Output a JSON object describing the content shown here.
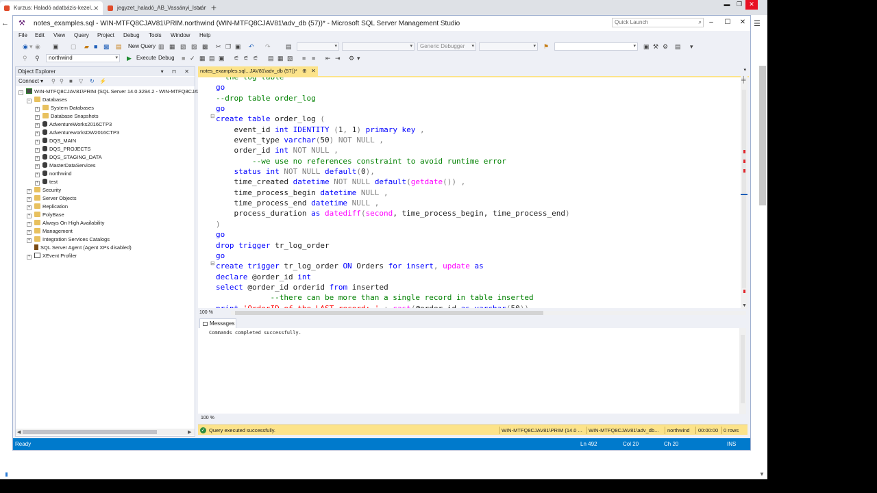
{
  "browser": {
    "tabs": [
      {
        "label": "Kurzus: Haladó adatbázis-kezel...",
        "active": true
      },
      {
        "label": "jegyzet_haladó_AB_Vassányi_István...",
        "active": false
      }
    ],
    "new_tab": "+",
    "window_controls": {
      "minimize": "▬",
      "maximize": "❐",
      "close": "✕"
    },
    "menu_icon": "☰",
    "back_icon": "←"
  },
  "ssms": {
    "title": "notes_examples.sql - WIN-MTFQ8CJAV81\\PRIM.northwind (WIN-MTFQ8CJAV81\\adv_db (57))* - Microsoft SQL Server Management Studio",
    "quick_launch": {
      "placeholder": "Quick Launch",
      "icon": "search-icon"
    },
    "window_controls": {
      "minimize": "‒",
      "maximize": "☐",
      "close": "✕"
    },
    "menu": [
      "File",
      "Edit",
      "View",
      "Query",
      "Project",
      "Debug",
      "Tools",
      "Window",
      "Help"
    ],
    "toolbar1": {
      "new_query": "New Query",
      "generic_debugger": "Generic Debugger"
    },
    "toolbar2": {
      "database": "northwind",
      "execute": "Execute",
      "debug": "Debug"
    },
    "object_explorer": {
      "title": "Object Explorer",
      "header_buttons": "▾ ⊓ ✕",
      "connect": "Connect ▾",
      "tree": [
        {
          "label": "WIN-MTFQ8CJAV81\\PRIM (SQL Server 14.0.3294.2 - WIN-MTFQ8CJAV81\\adv_db)",
          "level": 0,
          "icon": "server",
          "expander": "−"
        },
        {
          "label": "Databases",
          "level": 1,
          "icon": "folder",
          "expander": "−"
        },
        {
          "label": "System Databases",
          "level": 2,
          "icon": "folder",
          "expander": "+"
        },
        {
          "label": "Database Snapshots",
          "level": 2,
          "icon": "folder",
          "expander": "+"
        },
        {
          "label": "AdventureWorks2016CTP3",
          "level": 2,
          "icon": "db",
          "expander": "+"
        },
        {
          "label": "AdventureworksDW2016CTP3",
          "level": 2,
          "icon": "db",
          "expander": "+"
        },
        {
          "label": "DQS_MAIN",
          "level": 2,
          "icon": "db",
          "expander": "+"
        },
        {
          "label": "DQS_PROJECTS",
          "level": 2,
          "icon": "db",
          "expander": "+"
        },
        {
          "label": "DQS_STAGING_DATA",
          "level": 2,
          "icon": "db",
          "expander": "+"
        },
        {
          "label": "MasterDataServices",
          "level": 2,
          "icon": "db",
          "expander": "+"
        },
        {
          "label": "northwind",
          "level": 2,
          "icon": "db",
          "expander": "+"
        },
        {
          "label": "test",
          "level": 2,
          "icon": "db",
          "expander": "+"
        },
        {
          "label": "Security",
          "level": 1,
          "icon": "folder",
          "expander": "+"
        },
        {
          "label": "Server Objects",
          "level": 1,
          "icon": "folder",
          "expander": "+"
        },
        {
          "label": "Replication",
          "level": 1,
          "icon": "folder",
          "expander": "+"
        },
        {
          "label": "PolyBase",
          "level": 1,
          "icon": "folder",
          "expander": "+"
        },
        {
          "label": "Always On High Availability",
          "level": 1,
          "icon": "folder",
          "expander": "+"
        },
        {
          "label": "Management",
          "level": 1,
          "icon": "folder",
          "expander": "+"
        },
        {
          "label": "Integration Services Catalogs",
          "level": 1,
          "icon": "folder",
          "expander": "+"
        },
        {
          "label": "SQL Server Agent (Agent XPs disabled)",
          "level": 1,
          "icon": "agent",
          "expander": ""
        },
        {
          "label": "XEvent Profiler",
          "level": 1,
          "icon": "xevent",
          "expander": "+"
        }
      ]
    },
    "document_tab": {
      "label": "notes_examples.sql...JAV81\\adv_db (57))*",
      "pin": "⊕",
      "close": "✕"
    },
    "editor": {
      "zoom": "100 %",
      "lines": [
        [
          {
            "t": "  ",
            "c": "dk"
          },
          {
            "t": "the log table",
            "c": "cm"
          }
        ],
        [
          {
            "t": "go",
            "c": "kw"
          }
        ],
        [
          {
            "t": "--drop table order_log",
            "c": "cm"
          }
        ],
        [
          {
            "t": "go",
            "c": "kw"
          }
        ],
        [
          {
            "t": "create table",
            "c": "kw"
          },
          {
            "t": " order_log ",
            "c": "dk"
          },
          {
            "t": "(",
            "c": "gr"
          }
        ],
        [
          {
            "t": "    event_id ",
            "c": "dk"
          },
          {
            "t": "int IDENTITY",
            "c": "kw"
          },
          {
            "t": " (",
            "c": "gr"
          },
          {
            "t": "1",
            "c": "dk"
          },
          {
            "t": ", ",
            "c": "gr"
          },
          {
            "t": "1",
            "c": "dk"
          },
          {
            "t": ") ",
            "c": "gr"
          },
          {
            "t": "primary key",
            "c": "kw"
          },
          {
            "t": " ,",
            "c": "gr"
          }
        ],
        [
          {
            "t": "    event_type ",
            "c": "dk"
          },
          {
            "t": "varchar",
            "c": "kw"
          },
          {
            "t": "(",
            "c": "gr"
          },
          {
            "t": "50",
            "c": "dk"
          },
          {
            "t": ") NOT NULL ,",
            "c": "gr"
          }
        ],
        [
          {
            "t": "    order_id ",
            "c": "dk"
          },
          {
            "t": "int",
            "c": "kw"
          },
          {
            "t": " NOT NULL ,",
            "c": "gr"
          }
        ],
        [
          {
            "t": "        --we use no references constraint to avoid runtime error",
            "c": "cm"
          }
        ],
        [
          {
            "t": "    status ",
            "c": "kw"
          },
          {
            "t": "int",
            "c": "kw"
          },
          {
            "t": " NOT NULL ",
            "c": "gr"
          },
          {
            "t": "default",
            "c": "kw"
          },
          {
            "t": "(",
            "c": "gr"
          },
          {
            "t": "0",
            "c": "dk"
          },
          {
            "t": "),",
            "c": "gr"
          }
        ],
        [
          {
            "t": "    time_created ",
            "c": "dk"
          },
          {
            "t": "datetime",
            "c": "kw"
          },
          {
            "t": " NOT NULL ",
            "c": "gr"
          },
          {
            "t": "default",
            "c": "kw"
          },
          {
            "t": "(",
            "c": "gr"
          },
          {
            "t": "getdate",
            "c": "fn"
          },
          {
            "t": "()) ,",
            "c": "gr"
          }
        ],
        [
          {
            "t": "    time_process_begin ",
            "c": "dk"
          },
          {
            "t": "datetime",
            "c": "kw"
          },
          {
            "t": " NULL ,",
            "c": "gr"
          }
        ],
        [
          {
            "t": "    time_process_end ",
            "c": "dk"
          },
          {
            "t": "datetime",
            "c": "kw"
          },
          {
            "t": " NULL ,",
            "c": "gr"
          }
        ],
        [
          {
            "t": "    process_duration ",
            "c": "dk"
          },
          {
            "t": "as",
            "c": "kw"
          },
          {
            "t": " ",
            "c": "dk"
          },
          {
            "t": "datediff",
            "c": "fn"
          },
          {
            "t": "(",
            "c": "gr"
          },
          {
            "t": "second",
            "c": "fn"
          },
          {
            "t": ", time_process_begin, time_process_end",
            "c": "dk"
          },
          {
            "t": ")",
            "c": "gr"
          }
        ],
        [
          {
            "t": ")",
            "c": "gr"
          }
        ],
        [
          {
            "t": "go",
            "c": "kw"
          }
        ],
        [
          {
            "t": "drop trigger",
            "c": "kw"
          },
          {
            "t": " tr_log_order",
            "c": "dk"
          }
        ],
        [
          {
            "t": "go",
            "c": "kw"
          }
        ],
        [
          {
            "t": "create trigger",
            "c": "kw"
          },
          {
            "t": " tr_log_order ",
            "c": "dk"
          },
          {
            "t": "ON",
            "c": "kw"
          },
          {
            "t": " Orders ",
            "c": "dk"
          },
          {
            "t": "for insert",
            "c": "kw"
          },
          {
            "t": ", ",
            "c": "gr"
          },
          {
            "t": "update",
            "c": "fn"
          },
          {
            "t": " ",
            "c": "dk"
          },
          {
            "t": "as",
            "c": "kw"
          }
        ],
        [
          {
            "t": "declare",
            "c": "kw"
          },
          {
            "t": " @order_id ",
            "c": "dk"
          },
          {
            "t": "int",
            "c": "kw"
          }
        ],
        [
          {
            "t": "select",
            "c": "kw"
          },
          {
            "t": " @order_id orderid ",
            "c": "dk"
          },
          {
            "t": "from",
            "c": "kw"
          },
          {
            "t": " inserted",
            "c": "dk"
          }
        ],
        [
          {
            "t": "            --there can be more than a single record in table inserted",
            "c": "cm"
          }
        ],
        [
          {
            "t": "print",
            "c": "kw"
          },
          {
            "t": " ",
            "c": "dk"
          },
          {
            "t": "'OrderID of the LAST record: '",
            "c": "st"
          },
          {
            "t": " + ",
            "c": "gr"
          },
          {
            "t": "cast",
            "c": "fn"
          },
          {
            "t": "(",
            "c": "gr"
          },
          {
            "t": "@order_id ",
            "c": "dk"
          },
          {
            "t": "as varchar",
            "c": "kw"
          },
          {
            "t": "(",
            "c": "gr"
          },
          {
            "t": "50",
            "c": "dk"
          },
          {
            "t": "))",
            "c": "gr"
          }
        ]
      ]
    },
    "results": {
      "tab": "Messages",
      "message": "Commands completed successfully.",
      "zoom": "100 %"
    },
    "query_status": {
      "text": "Query executed successfully.",
      "server": "WIN-MTFQ8CJAV81\\PRIM (14.0 ...",
      "user": "WIN-MTFQ8CJAV81\\adv_db...",
      "database": "northwind",
      "elapsed": "00:00:00",
      "rows": "0 rows"
    },
    "statusbar": {
      "state": "Ready",
      "line": "Ln 492",
      "col": "Col 20",
      "ch": "Ch 20",
      "mode": "INS"
    }
  },
  "colors": {
    "status_blue": "#007acc",
    "query_yellow": "#fce38a",
    "keyword": "#0000ff",
    "comment": "#008000",
    "string": "#ff0000",
    "function": "#ff00ff"
  }
}
